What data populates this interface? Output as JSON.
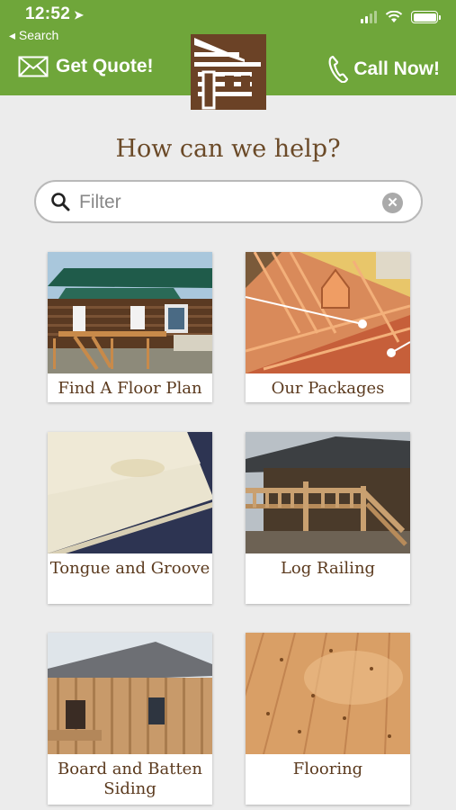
{
  "status_bar": {
    "time": "12:52",
    "back_label": "◂ Search"
  },
  "header": {
    "quote_label": "Get Quote!",
    "call_label": "Call Now!"
  },
  "page": {
    "heading": "How can we help?"
  },
  "search": {
    "placeholder": "Filter",
    "value": ""
  },
  "categories": [
    {
      "label": "Find A Floor Plan"
    },
    {
      "label": "Our Packages"
    },
    {
      "label": "Tongue and Groove"
    },
    {
      "label": "Log Railing"
    },
    {
      "label": "Board and Batten Siding"
    },
    {
      "label": "Flooring"
    }
  ],
  "colors": {
    "header_green": "#6fa63a",
    "brand_brown": "#6b4226",
    "heading_brown": "#6b4a28"
  }
}
